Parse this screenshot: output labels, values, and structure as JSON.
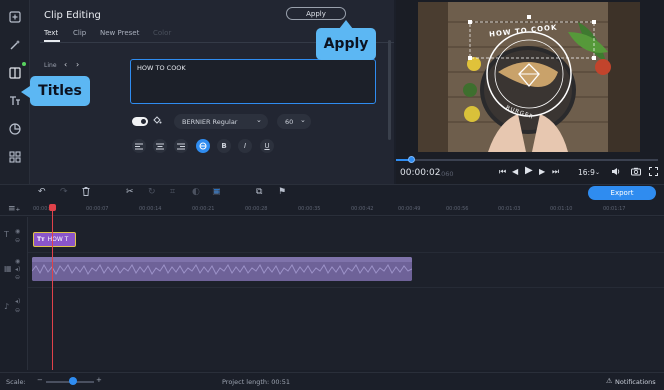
{
  "panel": {
    "title": "Clip Editing",
    "apply_label": "Apply",
    "tabs": [
      {
        "label": "Text"
      },
      {
        "label": "Clip"
      },
      {
        "label": "New Preset"
      },
      {
        "label": "Color"
      }
    ],
    "line_label": "Line",
    "text_value": "HOW TO COOK",
    "font_name": "BERNIER Regular",
    "font_size": "60"
  },
  "callouts": {
    "apply": "Apply",
    "titles": "Titles"
  },
  "preview": {
    "time_current": "00:00:02",
    "time_frames": ".060",
    "aspect_ratio": "16:9",
    "overlay_text_top": "HOW TO COOK",
    "overlay_text_bottom": "BURGER"
  },
  "toolbar": {
    "export_label": "Export"
  },
  "ruler": {
    "ticks": [
      "00:00:00",
      "00:00:07",
      "00:00:14",
      "00:00:21",
      "00:00:28",
      "00:00:35",
      "00:00:42",
      "00:00:49",
      "00:00:56",
      "00:01:03",
      "00:01:10",
      "00:01:17"
    ]
  },
  "timeline": {
    "title_clip_label": "HOW T"
  },
  "statusbar": {
    "scale_label": "Scale:",
    "project_length": "Project length:  00:51",
    "notifications_label": "Notifications"
  },
  "colors": {
    "accent": "#2f8cf0",
    "callout": "#5cb7f3",
    "title_clip": "#8a55c9",
    "playhead": "#e0424a"
  }
}
